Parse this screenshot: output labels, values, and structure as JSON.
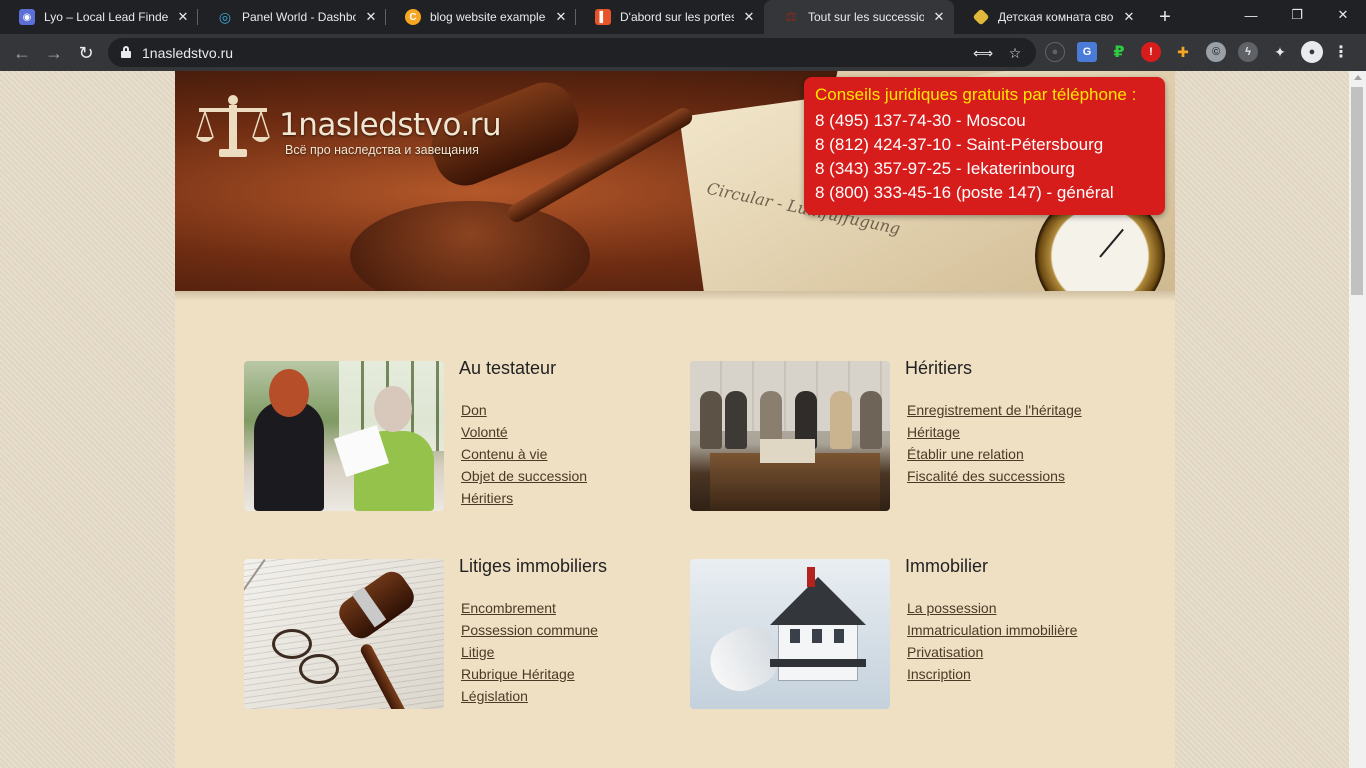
{
  "browser": {
    "tabs": [
      {
        "title": "Lyo – Local Lead Finder",
        "favicon": "robot-icon",
        "color": "#5b6fd6",
        "active": false
      },
      {
        "title": "Panel World - Dashboard",
        "favicon": "globe-icon",
        "color": "#3ea4d8",
        "active": false
      },
      {
        "title": "blog website examples",
        "favicon": "c-badge-icon",
        "color": "#f5a623",
        "active": false
      },
      {
        "title": "D'abord sur les portes -",
        "favicon": "bookmark-icon",
        "color": "#e8542a",
        "active": false
      },
      {
        "title": "Tout sur les successions",
        "favicon": "scales-icon",
        "color": "#8b2a1a",
        "active": true
      },
      {
        "title": "Детская комната свои",
        "favicon": "box-icon",
        "color": "#e0b93a",
        "active": false
      }
    ],
    "url": "1nasledstvo.ru"
  },
  "site": {
    "logo_name": "1nasledstvo.ru",
    "logo_tagline": "Всё про наследства и завещания",
    "banner_script": "Circular - Lumfuffügung",
    "phone_box": {
      "title": "Conseils juridiques gratuits par téléphone :",
      "lines": [
        "8 (495) 137-74-30 - Moscou",
        "8 (812) 424-37-10 - Saint-Pétersbourg",
        "8 (343) 357-97-25 - Iekaterinbourg",
        "8 (800) 333-45-16 (poste 147) - général"
      ]
    }
  },
  "sections": [
    {
      "heading": "Au testateur",
      "image": "meeting-photo",
      "links": [
        "Don",
        "Volonté",
        "Contenu à vie",
        "Objet de succession",
        "Héritiers"
      ]
    },
    {
      "heading": "Héritiers",
      "image": "family-photo",
      "links": [
        "Enregistrement de l'héritage",
        "Héritage",
        "Établir une relation",
        "Fiscalité des successions"
      ]
    },
    {
      "heading": "Litiges immobiliers",
      "image": "gavel-photo",
      "links": [
        "Encombrement",
        "Possession commune",
        "Litige",
        "Rubrique Héritage",
        "Législation"
      ]
    },
    {
      "heading": "Immobilier",
      "image": "house-photo",
      "links": [
        "La possession",
        "Immatriculation immobilière",
        "Privatisation",
        "Inscription"
      ]
    }
  ]
}
